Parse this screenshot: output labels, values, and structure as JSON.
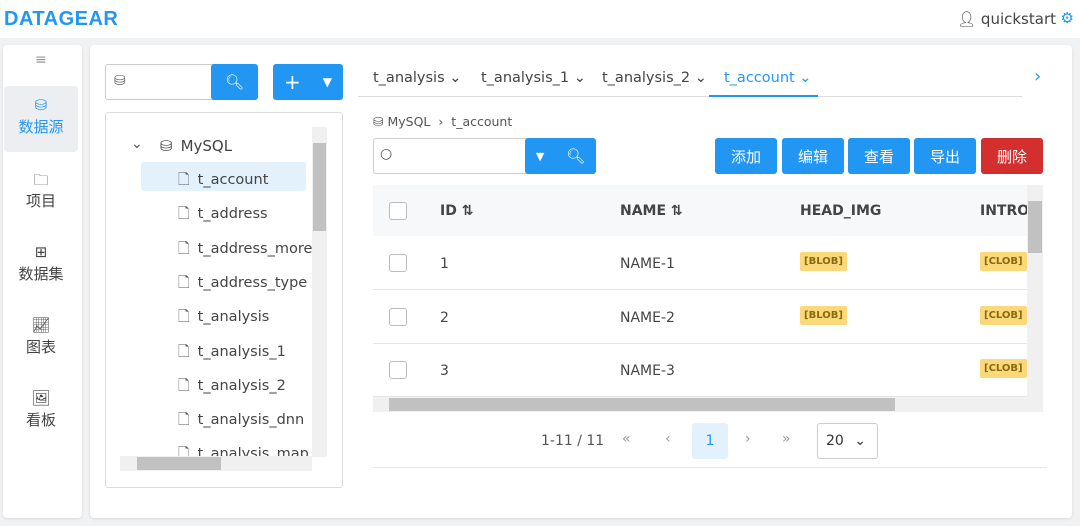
{
  "app": {
    "logo": "DATAGEAR",
    "user": "quickstart",
    "user_icon": "user-icon",
    "settings_icon": "gear-icon"
  },
  "sidebar": {
    "items": [
      {
        "label": "数据源",
        "icon": "database-icon",
        "active": true
      },
      {
        "label": "项目",
        "icon": "folder-icon"
      },
      {
        "label": "数据集",
        "icon": "table-icon"
      },
      {
        "label": "图表",
        "icon": "chart-icon"
      },
      {
        "label": "看板",
        "icon": "dashboard-icon"
      }
    ]
  },
  "tree": {
    "search_value": "",
    "root": "MySQL",
    "items": [
      "t_account",
      "t_address",
      "t_address_more",
      "t_address_type",
      "t_analysis",
      "t_analysis_1",
      "t_analysis_2",
      "t_analysis_dnn",
      "t_analysis_map"
    ],
    "selected": "t_account"
  },
  "tabs": [
    {
      "label": "t_analysis"
    },
    {
      "label": "t_analysis_1"
    },
    {
      "label": "t_analysis_2"
    },
    {
      "label": "t_account",
      "active": true
    }
  ],
  "breadcrumb": {
    "db": "MySQL",
    "table": "t_account"
  },
  "toolbar": {
    "search_value": "",
    "add": "添加",
    "edit": "编辑",
    "view": "查看",
    "export": "导出",
    "delete": "删除"
  },
  "table": {
    "columns": [
      "ID",
      "NAME",
      "HEAD_IMG",
      "INTRO"
    ],
    "rows": [
      {
        "id": "1",
        "name": "NAME-1",
        "head_img": "[BLOB]",
        "intro": "[CLOB]"
      },
      {
        "id": "2",
        "name": "NAME-2",
        "head_img": "[BLOB]",
        "intro": "[CLOB]"
      },
      {
        "id": "3",
        "name": "NAME-3",
        "head_img": "",
        "intro": "[CLOB]"
      }
    ]
  },
  "pagination": {
    "summary": "1-11 / 11",
    "current": "1",
    "page_size": "20"
  },
  "colors": {
    "primary": "#2196f3",
    "danger": "#d32f2f",
    "tag": "#fbd97a"
  }
}
